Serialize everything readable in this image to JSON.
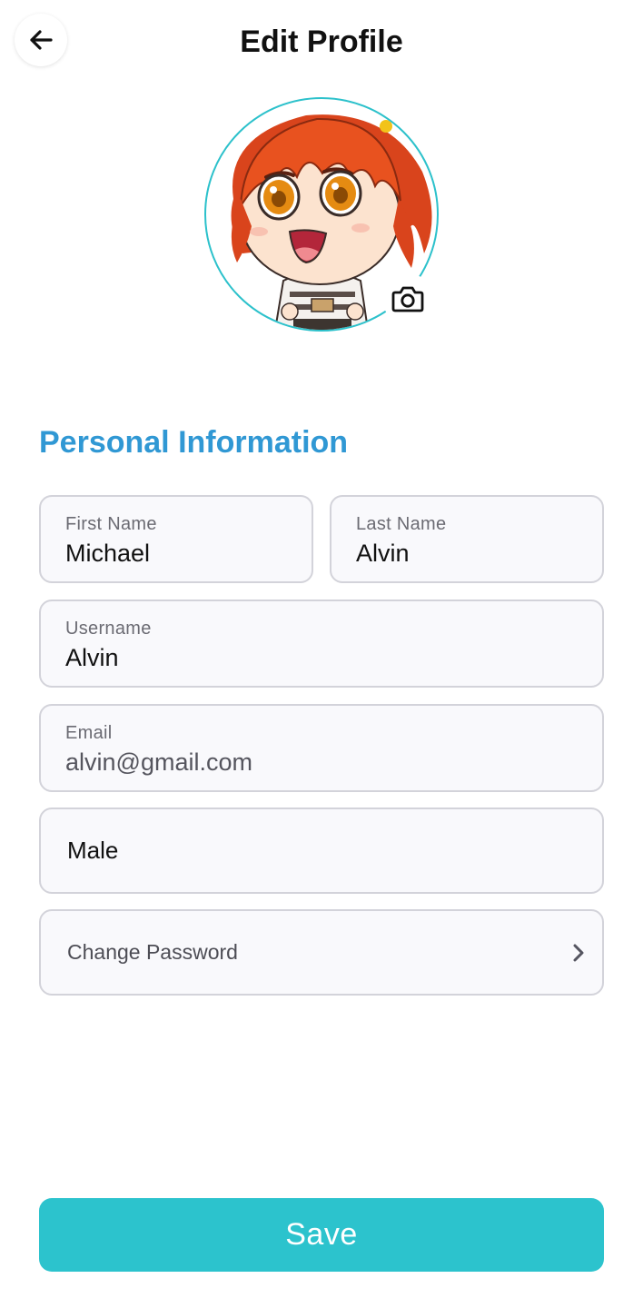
{
  "header": {
    "title": "Edit Profile",
    "back_icon": "arrow-left-icon"
  },
  "profile": {
    "avatar_icon": "avatar-image",
    "camera_icon": "camera-icon",
    "accent_color": "#2cc1cb"
  },
  "section": {
    "title": "Personal Information",
    "color": "#3098d4"
  },
  "form": {
    "first_name": {
      "label": "First Name",
      "value": "Michael"
    },
    "last_name": {
      "label": "Last Name",
      "value": "Alvin"
    },
    "username": {
      "label": "Username",
      "value": "Alvin"
    },
    "email": {
      "label": "Email",
      "value": "alvin@gmail.com"
    },
    "gender": {
      "value": "Male"
    },
    "change_password": {
      "label": "Change Password",
      "icon": "chevron-right-icon"
    }
  },
  "actions": {
    "save_label": "Save",
    "save_color": "#2cc3cd"
  }
}
